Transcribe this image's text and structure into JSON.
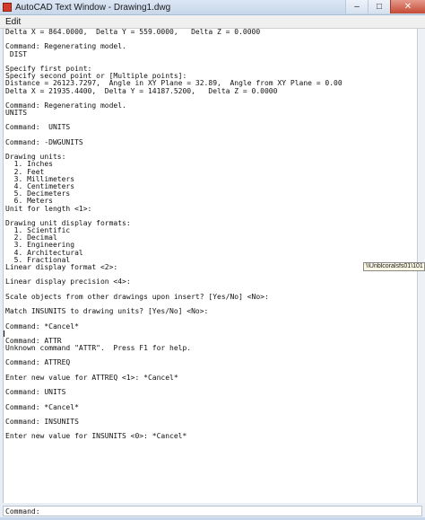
{
  "window": {
    "title": "AutoCAD Text Window - Drawing1.dwg"
  },
  "menu": {
    "items": [
      "Edit"
    ]
  },
  "output": {
    "lines": [
      "Delta X = 864.0000,  Delta Y = 559.0000,   Delta Z = 0.0000",
      "",
      "Command: Regenerating model.",
      " DIST",
      "",
      "Specify first point:",
      "Specify second point or [Multiple points]:",
      "Distance = 26123.7297,  Angle in XY Plane = 32.89,  Angle from XY Plane = 0.00",
      "Delta X = 21935.4400,  Delta Y = 14187.5200,   Delta Z = 0.0000",
      "",
      "Command: Regenerating model.",
      "UNITS",
      "",
      "Command:  UNITS",
      "",
      "Command: -DWGUNITS",
      "",
      "Drawing units:",
      "  1. Inches",
      "  2. Feet",
      "  3. Millimeters",
      "  4. Centimeters",
      "  5. Decimeters",
      "  6. Meters",
      "Unit for length <1>:",
      "",
      "Drawing unit display formats:",
      "  1. Scientific",
      "  2. Decimal",
      "  3. Engineering",
      "  4. Architectural",
      "  5. Fractional",
      "Linear display format <2>:",
      "",
      "Linear display precision <4>:",
      "",
      "Scale objects from other drawings upon insert? [Yes/No] <No>:",
      "",
      "Match INSUNITS to drawing units? [Yes/No] <No>:",
      "",
      "Command: *Cancel*",
      "",
      "Command: ATTR",
      "Unknown command \"ATTR\".  Press F1 for help.",
      "",
      "Command: ATTREQ",
      "",
      "Enter new value for ATTREQ <1>: *Cancel*",
      "",
      "Command: UNITS",
      "",
      "Command: *Cancel*",
      "",
      "Command: INSUNITS",
      "",
      "Enter new value for INSUNITS <0>: *Cancel*"
    ]
  },
  "command_line": {
    "label": "Command:",
    "value": ""
  },
  "tooltip": {
    "text": "\\\\Unblcoralsfs01\\101"
  }
}
